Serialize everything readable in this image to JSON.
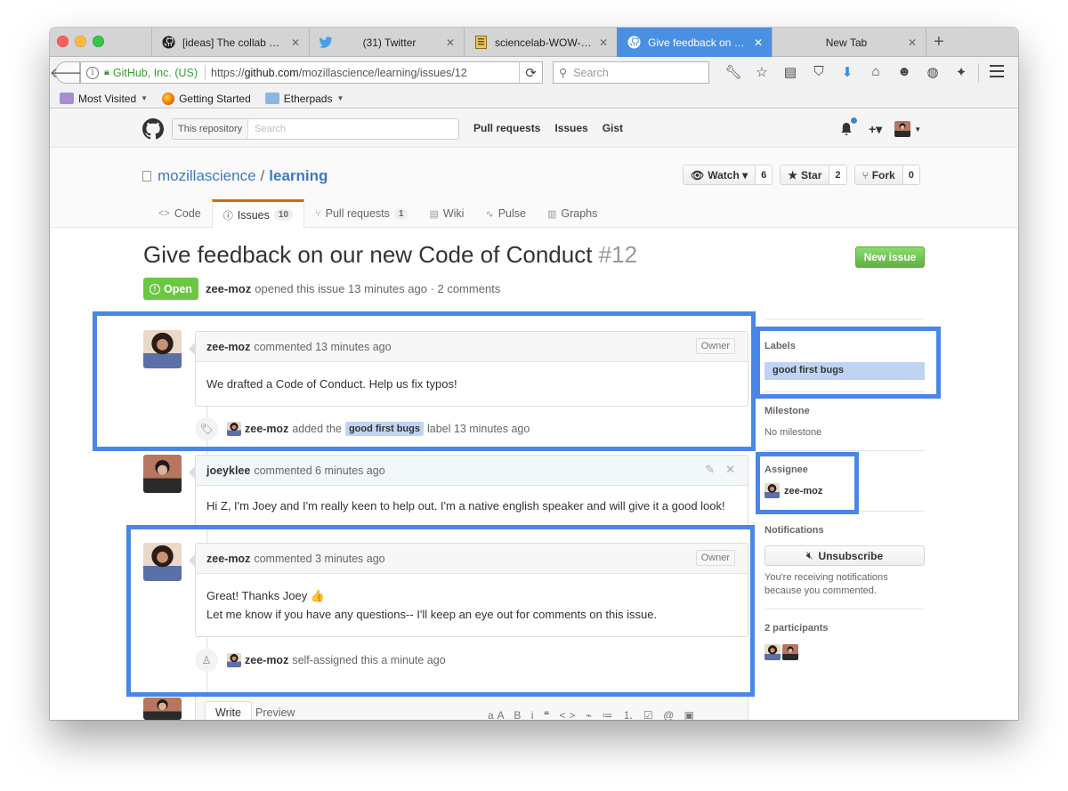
{
  "browser": {
    "tabs": [
      {
        "title": "[ideas] The collab co...",
        "icon": "github-icon"
      },
      {
        "title": "(31) Twitter",
        "icon": "twitter-icon"
      },
      {
        "title": "sciencelab-WOW-git...",
        "icon": "doc-icon"
      },
      {
        "title": "Give feedback on ou...",
        "icon": "github-icon",
        "active": true
      },
      {
        "title": "New Tab",
        "icon": ""
      }
    ],
    "close_glyph": "✕",
    "new_tab_glyph": "+",
    "url_org": "GitHub, Inc. (US)",
    "url_prefix": "https://",
    "url_host": "github.com",
    "url_path": "/mozillascience/learning/issues/12",
    "search_placeholder": "Search",
    "bookmarks": [
      {
        "label": "Most Visited",
        "caret": true
      },
      {
        "label": "Getting Started",
        "caret": false
      },
      {
        "label": "Etherpads",
        "caret": true
      }
    ]
  },
  "github": {
    "search_scope": "This repository",
    "search_placeholder": "Search",
    "nav": [
      "Pull requests",
      "Issues",
      "Gist"
    ],
    "plus": "+▾"
  },
  "repo": {
    "owner": "mozillascience",
    "name": "learning",
    "actions": [
      {
        "label": "Watch ▾",
        "icon": "eye-icon",
        "count": "6"
      },
      {
        "label": "Star",
        "icon": "star-icon",
        "count": "2"
      },
      {
        "label": "Fork",
        "icon": "fork-icon",
        "count": "0"
      }
    ],
    "tabs": [
      {
        "label": "Code",
        "icon": "<>",
        "counter": ""
      },
      {
        "label": "Issues",
        "icon": "ⓘ",
        "counter": "10",
        "active": true
      },
      {
        "label": "Pull requests",
        "icon": "⑂",
        "counter": "1"
      },
      {
        "label": "Wiki",
        "icon": "▤",
        "counter": ""
      },
      {
        "label": "Pulse",
        "icon": "∿",
        "counter": ""
      },
      {
        "label": "Graphs",
        "icon": "▥",
        "counter": ""
      }
    ]
  },
  "issue": {
    "title": "Give feedback on our new Code of Conduct",
    "number": "#12",
    "new_issue": "New issue",
    "state": "Open",
    "author": "zee-moz",
    "meta": "opened this issue 13 minutes ago · 2 comments"
  },
  "timeline": {
    "comments": [
      {
        "author": "zee-moz",
        "meta": "commented 13 minutes ago",
        "badge": "Owner",
        "body": [
          "We drafted a Code of Conduct. Help us fix typos!"
        ]
      },
      {
        "author": "joeyklee",
        "meta": "commented 6 minutes ago",
        "badge": "",
        "body": [
          "Hi Z, I'm Joey and I'm really keen to help out. I'm a native english speaker and will give it a good look!"
        ]
      },
      {
        "author": "zee-moz",
        "meta": "commented 3 minutes ago",
        "badge": "Owner",
        "body": [
          "Great! Thanks Joey 👍",
          "Let me know if you have any questions-- I'll keep an eye out for comments on this issue."
        ]
      }
    ],
    "label_event": {
      "author": "zee-moz",
      "pre": "added the",
      "label": "good first bugs",
      "post": "label 13 minutes ago"
    },
    "assign_event": {
      "author": "zee-moz",
      "text": "self-assigned this a minute ago"
    },
    "editor_tabs": [
      "Write",
      "Preview"
    ]
  },
  "sidebar": {
    "labels_heading": "Labels",
    "label": "good first bugs",
    "milestone_heading": "Milestone",
    "milestone": "No milestone",
    "assignee_heading": "Assignee",
    "assignee": "zee-moz",
    "notifications_heading": "Notifications",
    "unsubscribe": "Unsubscribe",
    "notif_text_1": "You're receiving notifications",
    "notif_text_2": "because you commented.",
    "participants_heading": "2 participants"
  },
  "colors": {
    "highlight": "#4a86e8",
    "tab_active": "#4a90e2",
    "label": "#bfd4f2",
    "open": "#6cc644",
    "link": "#4078c0"
  }
}
